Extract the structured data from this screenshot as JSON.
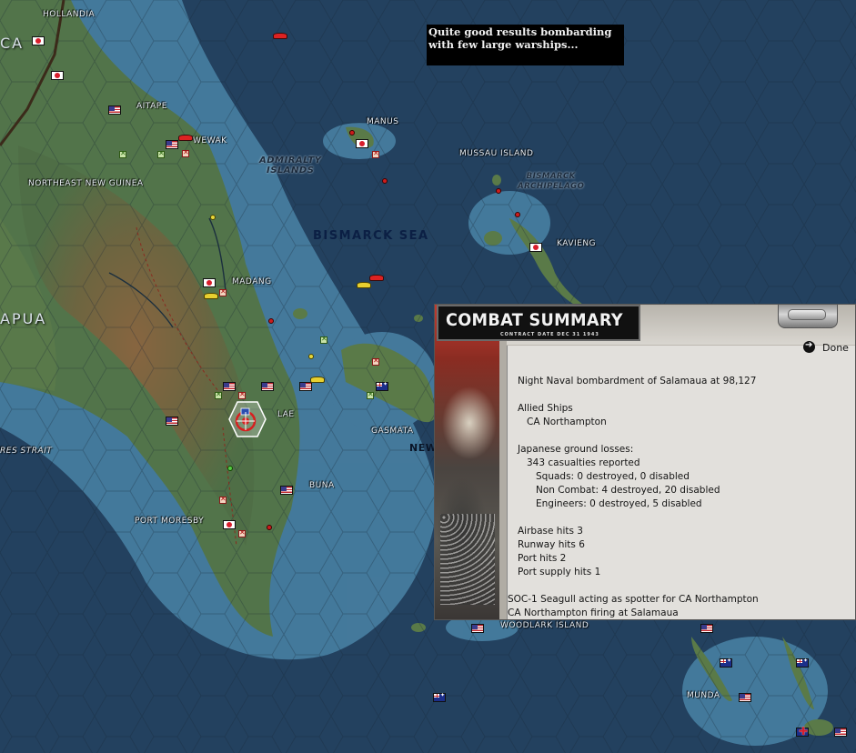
{
  "caption": {
    "line1": "Quite good results bombarding",
    "line2": "with few large warships..."
  },
  "map": {
    "labels": {
      "hollandia": "HOLLANDIA",
      "aitape": "AITAPE",
      "wewak": "WEWAK",
      "manus": "MANUS",
      "admiralty": "ADMIRALTY",
      "islands": "ISLANDS",
      "mussau_island": "MUSSAU ISLAND",
      "bismarck": "BISMARCK",
      "archipelago": "ARCHIPELAGO",
      "northeast_new_guinea": "NORTHEAST NEW GUINEA",
      "bismarck_sea": "BISMARCK SEA",
      "kavieng": "KAVIENG",
      "madang": "MADANG",
      "papua": "APUA",
      "lae": "LAE",
      "gasmata": "GASMATA",
      "new": "NEW",
      "strait": "RES STRAIT",
      "buna": "BUNA",
      "port_moresby": "PORT MORESBY",
      "woodlark_island": "WOODLARK ISLAND",
      "munda": "MUNDA",
      "ca": "CA"
    }
  },
  "combat_summary": {
    "title": "COMBAT SUMMARY",
    "subtitle": "CONTRACT DATE DEC 31 1943",
    "done_label": "Done",
    "report": {
      "headline": "Night Naval bombardment of Salamaua at 98,127",
      "allied_header": "Allied Ships",
      "allied_ship": "CA Northampton",
      "losses_header": "Japanese ground losses:",
      "casualties": "343 casualties reported",
      "squads": "Squads: 0 destroyed, 0 disabled",
      "non_combat": "Non Combat: 4 destroyed, 20 disabled",
      "engineers": "Engineers: 0 destroyed, 5 disabled",
      "airbase_hits": "Airbase hits 3",
      "runway_hits": "Runway hits 6",
      "port_hits": "Port hits 2",
      "port_supply_hits": "Port supply hits 1",
      "spotter": "SOC-1 Seagull acting as spotter for CA Northampton",
      "firing": "CA Northampton firing at Salamaua"
    }
  },
  "colors": {
    "sea_deep": "#23415f",
    "sea_shallow": "#5f9cb8",
    "land_low": "#50704a",
    "land_high": "#7a5a3a",
    "caption_bg": "#000000",
    "panel_bg": "#e2e0dc"
  }
}
